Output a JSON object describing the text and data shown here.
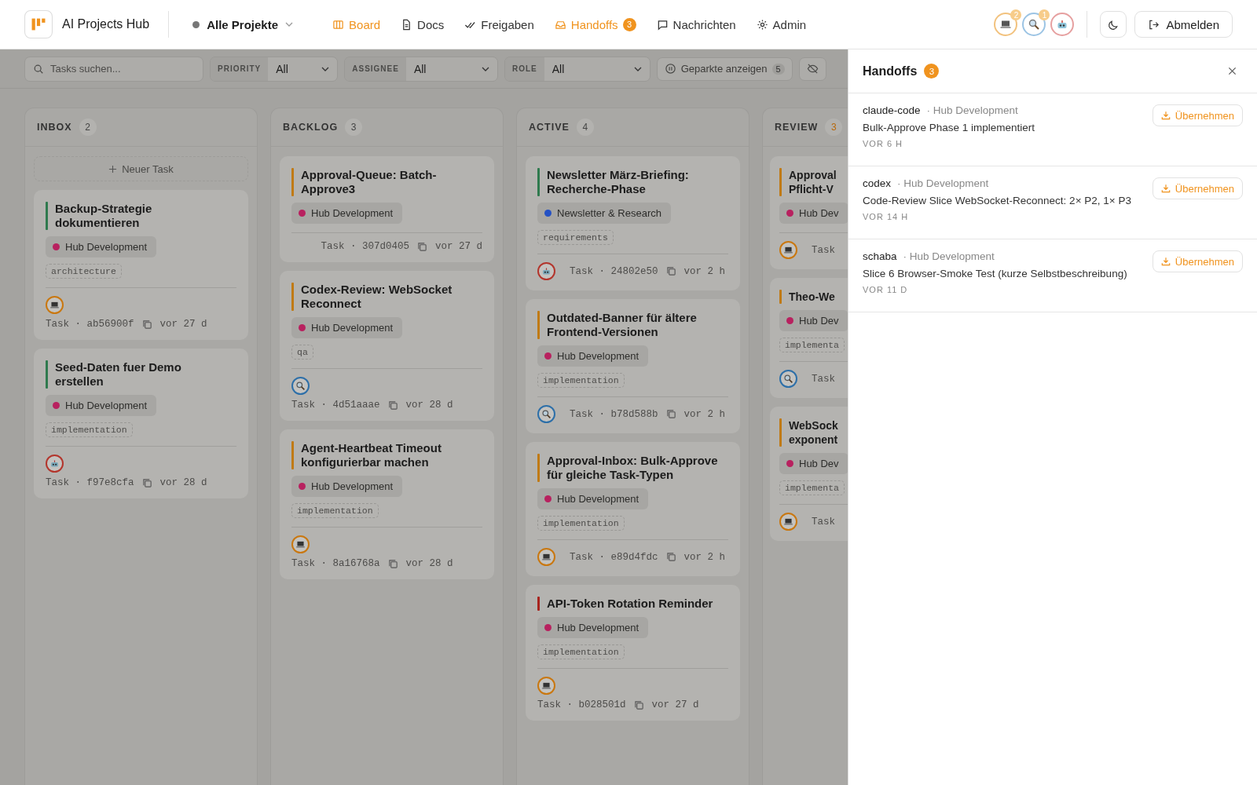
{
  "header": {
    "app_title": "AI Projects Hub",
    "project_select": "Alle Projekte",
    "nav": [
      {
        "label": "Board",
        "selected": true
      },
      {
        "label": "Docs",
        "selected": false
      },
      {
        "label": "Freigaben",
        "selected": false
      },
      {
        "label": "Handoffs",
        "selected": true,
        "badge": "3"
      },
      {
        "label": "Nachrichten",
        "selected": false
      },
      {
        "label": "Admin",
        "selected": false
      }
    ],
    "agents": [
      {
        "kind": "laptop",
        "badge": "2"
      },
      {
        "kind": "search",
        "badge": "1"
      },
      {
        "kind": "bot"
      }
    ],
    "logout": "Abmelden"
  },
  "toolbar": {
    "search": {
      "placeholder": "Tasks suchen..."
    },
    "filters": [
      {
        "label": "PRIORITY",
        "value": "All"
      },
      {
        "label": "ASSIGNEE",
        "value": "All"
      },
      {
        "label": "ROLE",
        "value": "All"
      }
    ],
    "parked": {
      "label": "Geparkte anzeigen",
      "count": "5"
    }
  },
  "columns": [
    {
      "title": "INBOX",
      "count": "2",
      "alert": false,
      "new_task": "Neuer Task",
      "cards": [
        {
          "title": "Backup-Strategie dokumentieren",
          "color": "#2f7a4e",
          "project": {
            "name": "Hub Development",
            "color": "#b8215f"
          },
          "tags": [
            "architecture"
          ],
          "avatar": {
            "kind": "laptop"
          },
          "meta": "Task · ab56900f",
          "age": "vor 27 d"
        },
        {
          "title": "Seed-Daten fuer Demo erstellen",
          "color": "#2f7a4e",
          "project": {
            "name": "Hub Development",
            "color": "#b8215f"
          },
          "tags": [
            "implementation"
          ],
          "avatar": {
            "kind": "bot"
          },
          "meta": "Task · f97e8cfa",
          "age": "vor 28 d"
        }
      ]
    },
    {
      "title": "BACKLOG",
      "count": "3",
      "alert": false,
      "cards": [
        {
          "title": "Approval-Queue: Batch-Approve3",
          "color": "#c07a14",
          "project": {
            "name": "Hub Development",
            "color": "#b8215f"
          },
          "meta": "Task · 307d0405",
          "age": "vor 27 d"
        },
        {
          "title": "Codex-Review: WebSocket Reconnect",
          "color": "#c07a14",
          "project": {
            "name": "Hub Development",
            "color": "#b8215f"
          },
          "tags": [
            "qa"
          ],
          "avatar": {
            "kind": "search"
          },
          "meta": "Task · 4d51aaae",
          "age": "vor 28 d"
        },
        {
          "title": "Agent-Heartbeat Timeout konfigurierbar machen",
          "color": "#c07a14",
          "project": {
            "name": "Hub Development",
            "color": "#b8215f"
          },
          "tags": [
            "implementation"
          ],
          "avatar": {
            "kind": "laptop"
          },
          "meta": "Task · 8a16768a",
          "age": "vor 28 d"
        }
      ]
    },
    {
      "title": "ACTIVE",
      "count": "4",
      "alert": false,
      "cards": [
        {
          "title": "Newsletter März-Briefing: Recherche-Phase",
          "color": "#2f7a4e",
          "project": {
            "name": "Newsletter & Research",
            "color": "#2451c4"
          },
          "tags": [
            "requirements"
          ],
          "avatar": {
            "kind": "bot"
          },
          "meta": "Task · 24802e50",
          "age": "vor 2 h"
        },
        {
          "title": "Outdated-Banner für ältere Frontend-Versionen",
          "color": "#c07a14",
          "project": {
            "name": "Hub Development",
            "color": "#b8215f"
          },
          "tags": [
            "implementation"
          ],
          "avatar": {
            "kind": "search"
          },
          "meta": "Task · b78d588b",
          "age": "vor 2 h"
        },
        {
          "title": "Approval-Inbox: Bulk-Approve für gleiche Task-Typen",
          "color": "#c07a14",
          "project": {
            "name": "Hub Development",
            "color": "#b8215f"
          },
          "tags": [
            "implementation"
          ],
          "avatar": {
            "kind": "laptop"
          },
          "meta": "Task · e89d4fdc",
          "age": "vor 2 h"
        },
        {
          "title": "API-Token Rotation Reminder",
          "color": "#a8231d",
          "project": {
            "name": "Hub Development",
            "color": "#b8215f"
          },
          "tags": [
            "implementation"
          ],
          "avatar": {
            "kind": "laptop"
          },
          "meta": "Task · b028501d",
          "age": "vor 27 d"
        }
      ]
    },
    {
      "title": "REVIEW",
      "count": "3",
      "alert": true,
      "cards": [
        {
          "title": "Approval Pflicht-V",
          "color": "#c07a14",
          "project": {
            "name": "Hub Dev",
            "color": "#b8215f"
          },
          "avatar": {
            "kind": "laptop"
          },
          "meta": "Task"
        },
        {
          "title": "Theo-We",
          "color": "#c07a14",
          "project": {
            "name": "Hub Dev",
            "color": "#b8215f"
          },
          "tags": [
            "implementa"
          ],
          "avatar": {
            "kind": "search"
          },
          "meta": "Task"
        },
        {
          "title": "WebSock exponent",
          "color": "#c07a14",
          "project": {
            "name": "Hub Dev",
            "color": "#b8215f"
          },
          "tags": [
            "implementa"
          ],
          "avatar": {
            "kind": "laptop"
          },
          "meta": "Task"
        }
      ]
    }
  ],
  "drawer": {
    "title": "Handoffs",
    "count": "3",
    "items": [
      {
        "agent": "claude-code",
        "project": "· Hub Development",
        "text": "Bulk-Approve Phase 1 implementiert",
        "time": "VOR 6 H",
        "action": "Übernehmen"
      },
      {
        "agent": "codex",
        "project": "· Hub Development",
        "text": "Code-Review Slice WebSocket-Reconnect: 2× P2, 1× P3",
        "time": "VOR 14 H",
        "action": "Übernehmen"
      },
      {
        "agent": "schaba",
        "project": "· Hub Development",
        "text": "Slice 6 Browser-Smoke Test (kurze Selbstbeschreibung)",
        "time": "VOR 11 D",
        "action": "Übernehmen"
      }
    ]
  }
}
